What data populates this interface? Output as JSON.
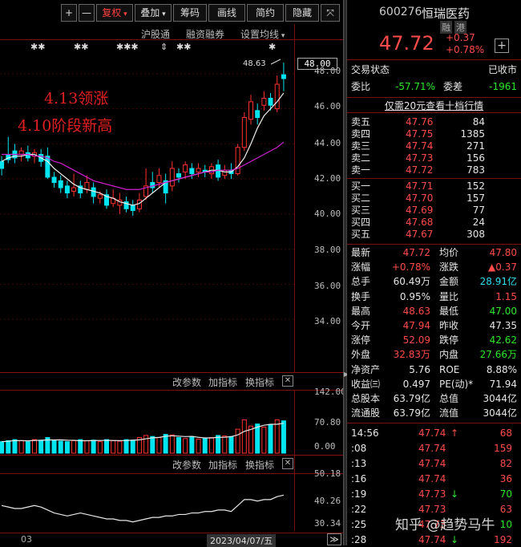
{
  "toolbar": {
    "plus": "+",
    "minus": "—",
    "fuquan": "复权",
    "diejia": "叠加",
    "chouma": "筹码",
    "huaxian": "画线",
    "jianyue": "简约",
    "yincang": "隐藏",
    "expand": "⤧"
  },
  "subbar": {
    "hgt": "沪股通",
    "rzrq": "融资融券",
    "mavg": "设置均线"
  },
  "markers": [
    "✱✱",
    "✱✱",
    "✱✱✱",
    "⇕",
    "✱✱",
    "✱"
  ],
  "annotations": {
    "a1": "4.13领涨",
    "a2": "4.10阶段新高",
    "peak": "48.63"
  },
  "price_axis": [
    "48.00",
    "46.00",
    "44.00",
    "42.00",
    "40.00",
    "38.00",
    "36.00",
    "34.00"
  ],
  "current_price_tag": "48.00",
  "indicator1": {
    "params": "改参数",
    "add": "加指标",
    "switch": "换指标",
    "close": "✕",
    "axis": [
      "142.00",
      "70.80",
      "0.00"
    ]
  },
  "indicator2": {
    "params": "改参数",
    "add": "加指标",
    "switch": "换指标",
    "close": "✕",
    "axis": [
      "50.18",
      "40.26",
      "30.34"
    ]
  },
  "bottom": {
    "left": "03",
    "date": "2023/04/07/五",
    "nav": "≫"
  },
  "stock": {
    "code": "600276",
    "name": "恒瑞医药",
    "badge1": "融",
    "badge2": "港",
    "price": "47.72",
    "change": "+0.37",
    "pct": "+0.78%",
    "add": "+"
  },
  "status": {
    "label": "交易状态",
    "value": "已收市"
  },
  "weibi": {
    "label1": "委比",
    "value1": "-57.71%",
    "label2": "委差",
    "value2": "-1961"
  },
  "promo": "仅需20元查看十档行情",
  "asks": [
    {
      "l": "卖五",
      "p": "47.76",
      "v": "84"
    },
    {
      "l": "卖四",
      "p": "47.75",
      "v": "1385"
    },
    {
      "l": "卖三",
      "p": "47.74",
      "v": "271"
    },
    {
      "l": "卖二",
      "p": "47.73",
      "v": "156"
    },
    {
      "l": "卖一",
      "p": "47.72",
      "v": "783"
    }
  ],
  "bids": [
    {
      "l": "买一",
      "p": "47.71",
      "v": "152"
    },
    {
      "l": "买二",
      "p": "47.70",
      "v": "157"
    },
    {
      "l": "买三",
      "p": "47.69",
      "v": "77"
    },
    {
      "l": "买四",
      "p": "47.68",
      "v": "24"
    },
    {
      "l": "买五",
      "p": "47.67",
      "v": "308"
    }
  ],
  "quotes": [
    {
      "l1": "最新",
      "v1": "47.72",
      "c1": "red",
      "l2": "均价",
      "v2": "47.80",
      "c2": "red"
    },
    {
      "l1": "涨幅",
      "v1": "+0.78%",
      "c1": "red",
      "l2": "涨跌",
      "v2": "▲0.37",
      "c2": "red"
    },
    {
      "l1": "总手",
      "v1": "60.49万",
      "c1": "white",
      "l2": "金额",
      "v2": "28.91亿",
      "c2": "cyan"
    },
    {
      "l1": "换手",
      "v1": "0.95%",
      "c1": "white",
      "l2": "量比",
      "v2": "1.15",
      "c2": "red"
    },
    {
      "l1": "最高",
      "v1": "48.63",
      "c1": "red",
      "l2": "最低",
      "v2": "47.00",
      "c2": "green"
    },
    {
      "l1": "今开",
      "v1": "47.94",
      "c1": "red",
      "l2": "昨收",
      "v2": "47.35",
      "c2": "white"
    },
    {
      "l1": "涨停",
      "v1": "52.09",
      "c1": "red",
      "l2": "跌停",
      "v2": "42.62",
      "c2": "green"
    },
    {
      "l1": "外盘",
      "v1": "32.83万",
      "c1": "red",
      "l2": "内盘",
      "v2": "27.66万",
      "c2": "green"
    },
    {
      "l1": "净资产",
      "v1": "5.76",
      "c1": "white",
      "l2": "ROE",
      "v2": "8.88%",
      "c2": "white"
    },
    {
      "l1": "收益㈢",
      "v1": "0.497",
      "c1": "white",
      "l2": "PE(动)*",
      "v2": "71.94",
      "c2": "white"
    },
    {
      "l1": "总股本",
      "v1": "63.79亿",
      "c1": "white",
      "l2": "总值",
      "v2": "3044亿",
      "c2": "white"
    },
    {
      "l1": "流通股",
      "v1": "63.79亿",
      "c1": "white",
      "l2": "流值",
      "v2": "3044亿",
      "c2": "white"
    }
  ],
  "ticks": [
    {
      "t": "14:56",
      "p": "47.74",
      "a": "↑",
      "ac": "red",
      "v": "68",
      "vc": "red"
    },
    {
      "t": ":08",
      "p": "47.74",
      "a": "",
      "ac": "red",
      "v": "159",
      "vc": "red"
    },
    {
      "t": ":13",
      "p": "47.74",
      "a": "",
      "ac": "red",
      "v": "82",
      "vc": "red"
    },
    {
      "t": ":16",
      "p": "47.74",
      "a": "",
      "ac": "red",
      "v": "36",
      "vc": "red"
    },
    {
      "t": ":19",
      "p": "47.73",
      "a": "↓",
      "ac": "green",
      "v": "70",
      "vc": "green"
    },
    {
      "t": ":22",
      "p": "47.73",
      "a": "",
      "ac": "red",
      "v": "63",
      "vc": "red"
    },
    {
      "t": ":25",
      "p": "47.73",
      "a": "",
      "ac": "red",
      "v": "10",
      "vc": "green"
    },
    {
      "t": ":28",
      "p": "47.74",
      "a": "↓",
      "ac": "green",
      "v": "192",
      "vc": "red"
    }
  ],
  "watermark": "知乎 @趋势马牛",
  "chart_data": {
    "type": "candlestick",
    "ylim": [
      33,
      49
    ],
    "candles": [
      {
        "o": 43.0,
        "c": 42.6,
        "h": 43.3,
        "l": 42.2
      },
      {
        "o": 43.4,
        "c": 43.1,
        "h": 44.4,
        "l": 42.9
      },
      {
        "o": 43.6,
        "c": 43.2,
        "h": 44.0,
        "l": 42.9
      },
      {
        "o": 43.4,
        "c": 43.6,
        "h": 43.8,
        "l": 43.0
      },
      {
        "o": 43.5,
        "c": 43.2,
        "h": 43.9,
        "l": 43.0
      },
      {
        "o": 43.3,
        "c": 43.5,
        "h": 43.7,
        "l": 42.9
      },
      {
        "o": 43.4,
        "c": 43.0,
        "h": 43.7,
        "l": 42.7
      },
      {
        "o": 43.3,
        "c": 42.1,
        "h": 43.8,
        "l": 42.0
      },
      {
        "o": 42.1,
        "c": 41.8,
        "h": 42.4,
        "l": 41.5
      },
      {
        "o": 41.9,
        "c": 41.5,
        "h": 42.2,
        "l": 41.2
      },
      {
        "o": 41.6,
        "c": 41.2,
        "h": 41.9,
        "l": 40.9
      },
      {
        "o": 41.3,
        "c": 41.5,
        "h": 42.3,
        "l": 41.0
      },
      {
        "o": 41.6,
        "c": 41.2,
        "h": 41.9,
        "l": 40.9
      },
      {
        "o": 41.4,
        "c": 41.8,
        "h": 42.2,
        "l": 41.2
      },
      {
        "o": 41.5,
        "c": 41.0,
        "h": 41.8,
        "l": 40.6
      },
      {
        "o": 40.9,
        "c": 41.1,
        "h": 41.3,
        "l": 40.6
      },
      {
        "o": 41.1,
        "c": 40.5,
        "h": 41.4,
        "l": 40.3
      },
      {
        "o": 40.6,
        "c": 40.9,
        "h": 41.4,
        "l": 40.4
      },
      {
        "o": 40.5,
        "c": 40.8,
        "h": 41.2,
        "l": 40.0
      },
      {
        "o": 40.7,
        "c": 40.3,
        "h": 41.0,
        "l": 40.1
      },
      {
        "o": 40.5,
        "c": 40.2,
        "h": 40.8,
        "l": 39.9
      },
      {
        "o": 40.3,
        "c": 40.8,
        "h": 41.2,
        "l": 40.1
      },
      {
        "o": 41.0,
        "c": 41.6,
        "h": 42.6,
        "l": 40.8
      },
      {
        "o": 41.8,
        "c": 41.5,
        "h": 42.4,
        "l": 41.2
      },
      {
        "o": 41.8,
        "c": 42.2,
        "h": 42.6,
        "l": 41.5
      },
      {
        "o": 41.9,
        "c": 41.2,
        "h": 42.3,
        "l": 40.6
      },
      {
        "o": 41.6,
        "c": 42.6,
        "h": 43.0,
        "l": 41.3
      },
      {
        "o": 42.3,
        "c": 42.1,
        "h": 42.6,
        "l": 41.8
      },
      {
        "o": 42.4,
        "c": 42.8,
        "h": 43.0,
        "l": 42.0
      },
      {
        "o": 42.6,
        "c": 42.3,
        "h": 42.9,
        "l": 42.0
      },
      {
        "o": 42.4,
        "c": 42.6,
        "h": 42.9,
        "l": 42.1
      },
      {
        "o": 42.5,
        "c": 42.4,
        "h": 42.8,
        "l": 42.1
      },
      {
        "o": 42.3,
        "c": 42.7,
        "h": 42.9,
        "l": 42.0
      },
      {
        "o": 42.8,
        "c": 42.1,
        "h": 43.1,
        "l": 41.9
      },
      {
        "o": 42.2,
        "c": 42.5,
        "h": 42.8,
        "l": 42.0
      },
      {
        "o": 42.5,
        "c": 42.3,
        "h": 42.9,
        "l": 42.0
      },
      {
        "o": 42.3,
        "c": 43.8,
        "h": 44.0,
        "l": 42.2
      },
      {
        "o": 43.8,
        "c": 45.5,
        "h": 45.8,
        "l": 43.6
      },
      {
        "o": 45.4,
        "c": 46.4,
        "h": 46.8,
        "l": 45.1
      },
      {
        "o": 45.9,
        "c": 45.5,
        "h": 46.3,
        "l": 45.1
      },
      {
        "o": 46.2,
        "c": 46.6,
        "h": 47.0,
        "l": 45.9
      },
      {
        "o": 46.6,
        "c": 46.2,
        "h": 46.9,
        "l": 45.9
      },
      {
        "o": 46.0,
        "c": 47.4,
        "h": 47.9,
        "l": 45.8
      },
      {
        "o": 47.94,
        "c": 47.72,
        "h": 48.63,
        "l": 47.0
      }
    ],
    "ma5": [
      43.0,
      43.2,
      43.3,
      43.3,
      43.4,
      43.4,
      43.2,
      43.0,
      42.6,
      42.3,
      42.0,
      41.7,
      41.5,
      41.4,
      41.3,
      41.2,
      41.0,
      40.9,
      40.7,
      40.6,
      40.5,
      40.6,
      40.9,
      41.2,
      41.5,
      41.8,
      41.9,
      42.0,
      42.1,
      42.2,
      42.3,
      42.4,
      42.5,
      42.5,
      42.4,
      42.4,
      42.7,
      43.2,
      44.0,
      44.9,
      45.6,
      46.0,
      46.4,
      46.9
    ],
    "ma20": [
      43.4,
      43.4,
      43.4,
      43.4,
      43.4,
      43.3,
      43.3,
      43.2,
      43.0,
      42.9,
      42.7,
      42.5,
      42.3,
      42.1,
      41.9,
      41.8,
      41.7,
      41.6,
      41.5,
      41.4,
      41.4,
      41.4,
      41.5,
      41.6,
      41.7,
      41.8,
      41.9,
      42.0,
      42.1,
      42.2,
      42.3,
      42.4,
      42.4,
      42.5,
      42.5,
      42.5,
      42.6,
      42.8,
      43.0,
      43.2,
      43.4,
      43.6,
      43.8,
      44.1
    ],
    "volume": [
      22,
      24,
      26,
      24,
      22,
      26,
      25,
      30,
      24,
      23,
      22,
      24,
      26,
      24,
      25,
      22,
      26,
      24,
      23,
      26,
      25,
      30,
      34,
      32,
      30,
      36,
      35,
      30,
      28,
      32,
      27,
      29,
      30,
      34,
      33,
      32,
      46,
      64,
      52,
      56,
      50,
      55,
      64,
      62
    ],
    "rsi": [
      36,
      35,
      34,
      34,
      35,
      36,
      35,
      33,
      31,
      30,
      29,
      30,
      31,
      30,
      29,
      28,
      27,
      27,
      26,
      26,
      25,
      26,
      27,
      28,
      28,
      29,
      29,
      30,
      30,
      31,
      31,
      32,
      32,
      33,
      33,
      32,
      36,
      40,
      40,
      39,
      40,
      40,
      42,
      43
    ]
  }
}
